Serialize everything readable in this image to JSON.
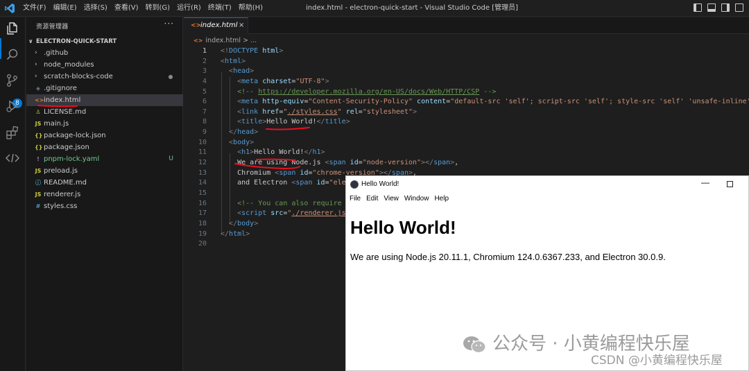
{
  "titlebar": {
    "menus": [
      "文件(F)",
      "编辑(E)",
      "选择(S)",
      "查看(V)",
      "转到(G)",
      "运行(R)",
      "终端(T)",
      "帮助(H)"
    ],
    "window_title": "index.html - electron-quick-start - Visual Studio Code [管理员]",
    "layout_icons": [
      "toggle-primary-sidebar-icon",
      "toggle-panel-icon",
      "toggle-secondary-sidebar-icon",
      "customize-layout-icon"
    ]
  },
  "activitybar": {
    "icons": [
      "explorer-icon",
      "search-icon",
      "source-control-icon",
      "run-debug-icon",
      "extensions-icon",
      "remote-explorer-icon"
    ],
    "scm_badge": "8"
  },
  "sidebar": {
    "header": "资源管理器",
    "more": "···",
    "folder": "ELECTRON-QUICK-START",
    "items": [
      {
        "name": ".github",
        "type": "folder"
      },
      {
        "name": "node_modules",
        "type": "folder"
      },
      {
        "name": "scratch-blocks-code",
        "type": "folder",
        "modified": true
      },
      {
        "name": ".gitignore",
        "type": "gitignore",
        "icon": "◈"
      },
      {
        "name": "index.html",
        "type": "html",
        "icon": "<>",
        "selected": true
      },
      {
        "name": "LICENSE.md",
        "type": "license",
        "icon": "♙"
      },
      {
        "name": "main.js",
        "type": "js",
        "icon": "JS"
      },
      {
        "name": "package-lock.json",
        "type": "json",
        "icon": "{}"
      },
      {
        "name": "package.json",
        "type": "json",
        "icon": "{}"
      },
      {
        "name": "pnpm-lock.yaml",
        "type": "yaml",
        "icon": "!",
        "status": "U"
      },
      {
        "name": "preload.js",
        "type": "js",
        "icon": "JS"
      },
      {
        "name": "README.md",
        "type": "md",
        "icon": "ⓘ"
      },
      {
        "name": "renderer.js",
        "type": "js",
        "icon": "JS"
      },
      {
        "name": "styles.css",
        "type": "css",
        "icon": "#"
      }
    ]
  },
  "editor": {
    "tab": {
      "label": "index.html",
      "icon": "<>",
      "close": "×"
    },
    "breadcrumb": {
      "file": "index.html",
      "sep": " > ",
      "rest": "..."
    },
    "line_numbers": [
      "1",
      "2",
      "3",
      "4",
      "5",
      "6",
      "7",
      "8",
      "9",
      "10",
      "11",
      "12",
      "13",
      "14",
      "15",
      "16",
      "17",
      "18",
      "19",
      "20"
    ],
    "lines": [
      [
        [
          "brk",
          "<!"
        ],
        [
          "tag",
          "DOCTYPE"
        ],
        [
          "plain",
          " "
        ],
        [
          "attr",
          "html"
        ],
        [
          "brk",
          ">"
        ]
      ],
      [
        [
          "brk",
          "<"
        ],
        [
          "tag",
          "html"
        ],
        [
          "brk",
          ">"
        ]
      ],
      [
        [
          "plain",
          "  "
        ],
        [
          "brk",
          "<"
        ],
        [
          "tag",
          "head"
        ],
        [
          "brk",
          ">"
        ]
      ],
      [
        [
          "plain",
          "    "
        ],
        [
          "brk",
          "<"
        ],
        [
          "tag",
          "meta"
        ],
        [
          "plain",
          " "
        ],
        [
          "attr",
          "charset"
        ],
        [
          "plain",
          "="
        ],
        [
          "val",
          "\"UTF-8\""
        ],
        [
          "brk",
          ">"
        ]
      ],
      [
        [
          "plain",
          "    "
        ],
        [
          "com",
          "<!-- "
        ],
        [
          "lnk",
          "https://developer.mozilla.org/en-US/docs/Web/HTTP/CSP"
        ],
        [
          "com",
          " -->"
        ]
      ],
      [
        [
          "plain",
          "    "
        ],
        [
          "brk",
          "<"
        ],
        [
          "tag",
          "meta"
        ],
        [
          "plain",
          " "
        ],
        [
          "attr",
          "http-equiv"
        ],
        [
          "plain",
          "="
        ],
        [
          "val",
          "\"Content-Security-Policy\""
        ],
        [
          "plain",
          " "
        ],
        [
          "attr",
          "content"
        ],
        [
          "plain",
          "="
        ],
        [
          "val",
          "\"default-src 'self'; script-src 'self'; style-src 'self' 'unsafe-inline'\""
        ]
      ],
      [
        [
          "plain",
          "    "
        ],
        [
          "brk",
          "<"
        ],
        [
          "tag",
          "link"
        ],
        [
          "plain",
          " "
        ],
        [
          "attr",
          "href"
        ],
        [
          "plain",
          "="
        ],
        [
          "val",
          "\""
        ],
        [
          "valu",
          "./styles.css"
        ],
        [
          "val",
          "\""
        ],
        [
          "plain",
          " "
        ],
        [
          "attr",
          "rel"
        ],
        [
          "plain",
          "="
        ],
        [
          "val",
          "\"stylesheet\""
        ],
        [
          "brk",
          ">"
        ]
      ],
      [
        [
          "plain",
          "    "
        ],
        [
          "brk",
          "<"
        ],
        [
          "tag",
          "title"
        ],
        [
          "brk",
          ">"
        ],
        [
          "plain",
          "Hello World!"
        ],
        [
          "brk",
          "</"
        ],
        [
          "tag",
          "title"
        ],
        [
          "brk",
          ">"
        ]
      ],
      [
        [
          "plain",
          "  "
        ],
        [
          "brk",
          "</"
        ],
        [
          "tag",
          "head"
        ],
        [
          "brk",
          ">"
        ]
      ],
      [
        [
          "plain",
          "  "
        ],
        [
          "brk",
          "<"
        ],
        [
          "tag",
          "body"
        ],
        [
          "brk",
          ">"
        ]
      ],
      [
        [
          "plain",
          "    "
        ],
        [
          "brk",
          "<"
        ],
        [
          "tag",
          "h1"
        ],
        [
          "brk",
          ">"
        ],
        [
          "plain",
          "Hello World!"
        ],
        [
          "brk",
          "</"
        ],
        [
          "tag",
          "h1"
        ],
        [
          "brk",
          ">"
        ]
      ],
      [
        [
          "plain",
          "    We are using Node.js "
        ],
        [
          "brk",
          "<"
        ],
        [
          "tag",
          "span"
        ],
        [
          "plain",
          " "
        ],
        [
          "attr",
          "id"
        ],
        [
          "plain",
          "="
        ],
        [
          "val",
          "\"node-version\""
        ],
        [
          "brk",
          "></"
        ],
        [
          "tag",
          "span"
        ],
        [
          "brk",
          ">"
        ],
        [
          "plain",
          ","
        ]
      ],
      [
        [
          "plain",
          "    Chromium "
        ],
        [
          "brk",
          "<"
        ],
        [
          "tag",
          "span"
        ],
        [
          "plain",
          " "
        ],
        [
          "attr",
          "id"
        ],
        [
          "plain",
          "="
        ],
        [
          "val",
          "\"chrome-version\""
        ],
        [
          "brk",
          "></"
        ],
        [
          "tag",
          "span"
        ],
        [
          "brk",
          ">"
        ],
        [
          "plain",
          ","
        ]
      ],
      [
        [
          "plain",
          "    and Electron "
        ],
        [
          "brk",
          "<"
        ],
        [
          "tag",
          "span"
        ],
        [
          "plain",
          " "
        ],
        [
          "attr",
          "id"
        ],
        [
          "plain",
          "="
        ],
        [
          "val",
          "\"ele"
        ]
      ],
      [],
      [
        [
          "plain",
          "    "
        ],
        [
          "com",
          "<!-- You can also require o"
        ]
      ],
      [
        [
          "plain",
          "    "
        ],
        [
          "brk",
          "<"
        ],
        [
          "tag",
          "script"
        ],
        [
          "plain",
          " "
        ],
        [
          "attr",
          "src"
        ],
        [
          "plain",
          "="
        ],
        [
          "val",
          "\""
        ],
        [
          "valu",
          "./renderer.js"
        ]
      ],
      [
        [
          "plain",
          "  "
        ],
        [
          "brk",
          "</"
        ],
        [
          "tag",
          "body"
        ],
        [
          "brk",
          ">"
        ]
      ],
      [
        [
          "brk",
          "</"
        ],
        [
          "tag",
          "html"
        ],
        [
          "brk",
          ">"
        ]
      ],
      []
    ]
  },
  "app_window": {
    "title": "Hello World!",
    "menu": [
      "File",
      "Edit",
      "View",
      "Window",
      "Help"
    ],
    "minimize": "—",
    "heading": "Hello World!",
    "paragraph": "We are using Node.js 20.11.1, Chromium 124.0.6367.233, and Electron 30.0.9."
  },
  "watermarks": {
    "wechat": "公众号 · 小黄编程快乐屋",
    "csdn": "CSDN @小黄编程快乐屋"
  },
  "colors": {
    "accent": "#0078d4",
    "annotation": "#e81123",
    "html_icon": "#e37933",
    "js_icon": "#cbcb41",
    "json_icon": "#cbcb41",
    "css_icon": "#519aba",
    "md_icon": "#519aba",
    "yaml_icon": "#a074c4"
  }
}
